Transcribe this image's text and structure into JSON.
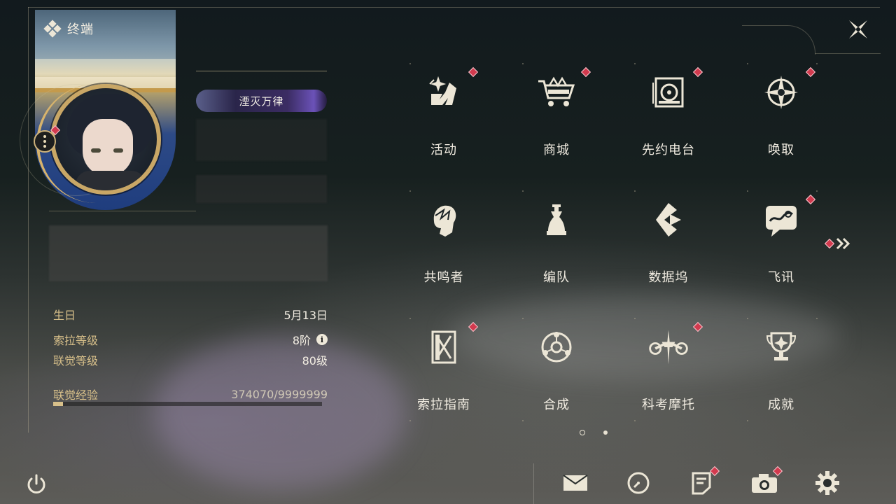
{
  "header": {
    "title": "终端",
    "icon": "diamond-cluster-icon"
  },
  "close": {
    "icon": "close-icon"
  },
  "profile": {
    "title_badge": "湮灭万律",
    "stats": [
      {
        "label": "生日",
        "value": "5月13日"
      },
      {
        "label": "索拉等级",
        "value": "8阶"
      },
      {
        "label": "联觉等级",
        "value": "80级"
      }
    ],
    "exp": {
      "label": "联觉经验",
      "value": "374070/9999999",
      "progress": 0.037
    }
  },
  "menu": [
    {
      "label": "活动",
      "icon": "activity-icon",
      "badge": true
    },
    {
      "label": "商城",
      "icon": "shop-cart-icon",
      "badge": true
    },
    {
      "label": "先约电台",
      "icon": "radio-icon",
      "badge": true
    },
    {
      "label": "唤取",
      "icon": "compass-star-icon",
      "badge": true
    },
    {
      "label": "共鸣者",
      "icon": "resonator-head-icon",
      "badge": false
    },
    {
      "label": "编队",
      "icon": "chess-team-icon",
      "badge": false
    },
    {
      "label": "数据坞",
      "icon": "data-dock-icon",
      "badge": false
    },
    {
      "label": "飞讯",
      "icon": "message-icon",
      "badge": true
    },
    {
      "label": "索拉指南",
      "icon": "guide-book-icon",
      "badge": true
    },
    {
      "label": "合成",
      "icon": "synthesis-icon",
      "badge": false
    },
    {
      "label": "科考摩托",
      "icon": "motorbike-icon",
      "badge": true
    },
    {
      "label": "成就",
      "icon": "trophy-icon",
      "badge": false
    }
  ],
  "pagination": {
    "current": 1,
    "total": 2
  },
  "bottom_bar": [
    {
      "name": "mail",
      "icon": "mail-icon",
      "badge": false
    },
    {
      "name": "clock",
      "icon": "clock-icon",
      "badge": false
    },
    {
      "name": "notice",
      "icon": "notice-icon",
      "badge": true
    },
    {
      "name": "camera",
      "icon": "camera-icon",
      "badge": true
    },
    {
      "name": "settings",
      "icon": "gear-icon",
      "badge": false
    }
  ],
  "colors": {
    "gold": "#d8c08a",
    "badge": "#d23a4e",
    "text": "#f2ede2"
  }
}
